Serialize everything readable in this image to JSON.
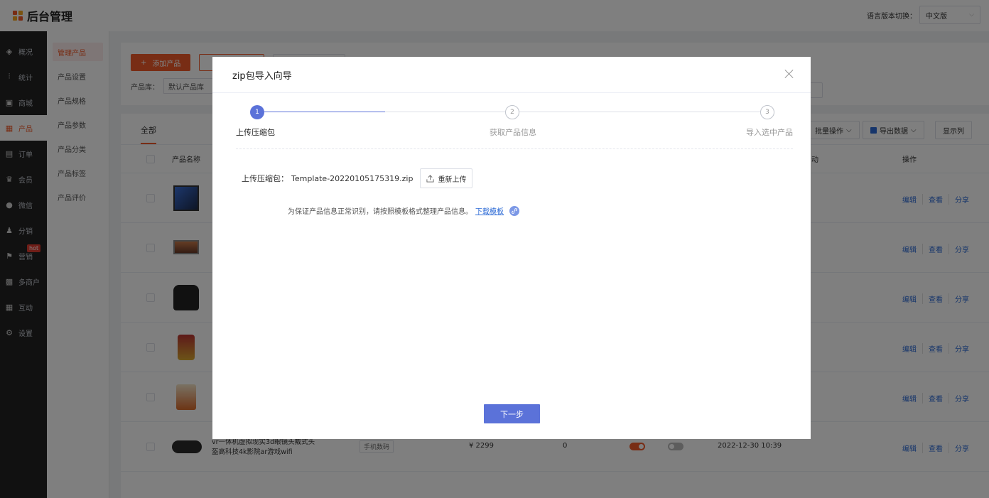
{
  "header": {
    "app_title": "后台管理",
    "lang_label": "语言版本切换：",
    "lang_value": "中文版"
  },
  "sidebar": {
    "items": [
      {
        "label": "概况",
        "icon": "dashboard-icon"
      },
      {
        "label": "统计",
        "icon": "chart-icon"
      },
      {
        "label": "商城",
        "icon": "shop-icon"
      },
      {
        "label": "产品",
        "icon": "product-icon"
      },
      {
        "label": "订单",
        "icon": "order-icon"
      },
      {
        "label": "会员",
        "icon": "crown-icon"
      },
      {
        "label": "微信",
        "icon": "wechat-icon"
      },
      {
        "label": "分销",
        "icon": "users-icon"
      },
      {
        "label": "营销",
        "icon": "flag-icon",
        "badge": "hot"
      },
      {
        "label": "多商户",
        "icon": "merchant-icon"
      },
      {
        "label": "互动",
        "icon": "grid-icon"
      },
      {
        "label": "设置",
        "icon": "gear-icon"
      }
    ]
  },
  "submenu": {
    "items": [
      "管理产品",
      "产品设置",
      "产品规格",
      "产品参数",
      "产品分类",
      "产品标签",
      "产品评价"
    ]
  },
  "toolbar": {
    "add_label": "添加产品",
    "library_label": "产品库：",
    "library_value": "默认产品库"
  },
  "table": {
    "tab_all": "全部",
    "bulk_label": "批量操作",
    "export_label": "导出数据",
    "columns_label": "显示列",
    "col_name": "产品名称",
    "col_action_partial": "动",
    "col_ops": "操作",
    "ops": {
      "edit": "编辑",
      "view": "查看",
      "share": "分享"
    },
    "last_row": {
      "name": "vr一体机虚拟现实3d眼镜头戴式头盔高科技4k影院ar游戏wifi",
      "tag": "手机数码",
      "price": "¥ 2299",
      "sales": "0",
      "time": "2022-12-30 10:39"
    }
  },
  "modal": {
    "title": "zip包导入向导",
    "steps": [
      {
        "num": "1",
        "label": "上传压缩包"
      },
      {
        "num": "2",
        "label": "获取产品信息"
      },
      {
        "num": "3",
        "label": "导入选中产品"
      }
    ],
    "upload_label": "上传压缩包：",
    "file_name": "Template-20220105175319.zip",
    "reupload_label": "重新上传",
    "hint_text": "为保证产品信息正常识别，请按照模板格式整理产品信息。",
    "download_link": "下载模板",
    "next_label": "下一步"
  },
  "colors": {
    "brand": "#f05a2a",
    "primary": "#5b72d9",
    "link": "#2d6bd6"
  }
}
